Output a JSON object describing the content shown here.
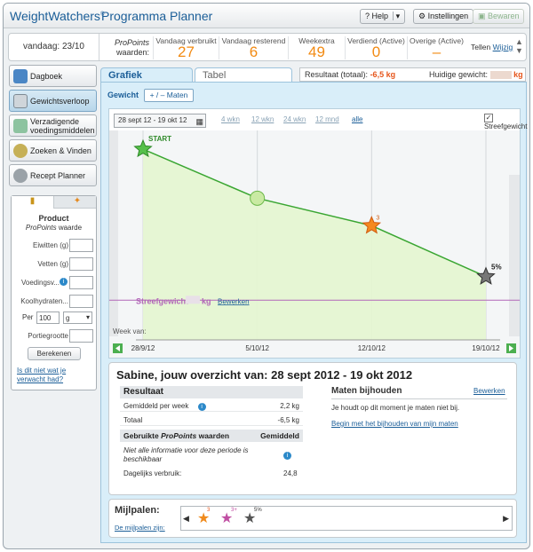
{
  "app": {
    "logo_text": "WeightWatchers",
    "logo_mark": "®",
    "title": "Programma Planner",
    "help_label": "Help",
    "settings_label": "Instellingen",
    "save_label": "Bewaren"
  },
  "stats": {
    "today_label": "vandaag: 23/10",
    "propoints_label": "ProPoints",
    "waarden_label": "waarden:",
    "items": [
      {
        "label": "Vandaag verbruikt",
        "value": "27"
      },
      {
        "label": "Vandaag resterend",
        "value": "6"
      },
      {
        "label": "Weekextra",
        "value": "49"
      },
      {
        "label": "Verdiend (Active)",
        "value": "0"
      },
      {
        "label": "Overige (Active)",
        "value": "–"
      }
    ],
    "tellen_label": "Tellen",
    "wijzig_label": "Wijzig"
  },
  "sidebar": {
    "items": [
      {
        "label": "Dagboek"
      },
      {
        "label": "Gewichtsverloop"
      },
      {
        "label": "Verzadigende voedingsmiddelen"
      },
      {
        "label": "Zoeken & Vinden"
      },
      {
        "label": "Recept Planner"
      }
    ]
  },
  "calculator": {
    "title": "Product",
    "subtitle_em": "ProPoints",
    "subtitle": "waarde",
    "fields": [
      "Eiwitten (g)",
      "Vetten (g)",
      "Voedingsv...",
      "Koolhydraten...",
      "Portiegrootte"
    ],
    "per_label": "Per",
    "per_value": "100",
    "unit_value": "g",
    "calc_button": "Berekenen",
    "help_link": "Is dit niet wat je verwacht had?"
  },
  "tabs": {
    "grafiek": "Grafiek",
    "tabel": "Tabel"
  },
  "results": {
    "label": "Resultaat (totaal):",
    "value": "-6,5 kg",
    "current_label": "Huidige gewicht:",
    "unit": "kg"
  },
  "chart_controls": {
    "weight_tab": "Gewicht",
    "measure_btn": "+ / – Maten",
    "date_range": "28 sept 12 - 19 okt 12",
    "ranges": [
      "4 wkn",
      "12 wkn",
      "24 wkn",
      "12 mnd",
      "alle"
    ],
    "target_checkbox": "Streefgewicht"
  },
  "chart_data": {
    "type": "area",
    "x": [
      "28/9/12",
      "5/10/12",
      "12/10/12",
      "19/10/12"
    ],
    "x_axis_label": "Week van:",
    "points": [
      {
        "date": "28/9/12",
        "marker": "START"
      },
      {
        "date": "5/10/12",
        "marker": ""
      },
      {
        "date": "12/10/12",
        "marker": "3"
      },
      {
        "date": "19/10/12",
        "marker": "5%"
      }
    ],
    "weight_change_kg": [
      0,
      -2.5,
      -3.9,
      -6.5
    ],
    "target_label": "Streefgewicht",
    "target_unit": "kg",
    "target_edit": "Bewerken",
    "colors": {
      "line": "#3aa632",
      "fill": "#e5f5d2",
      "target": "#b267b8"
    }
  },
  "summary": {
    "title": "Sabine, jouw overzicht van: 28 sept 2012 - 19 okt 2012",
    "resultaat_header": "Resultaat",
    "rows": [
      {
        "label": "Gemiddeld per week",
        "value": "2,2 kg"
      },
      {
        "label": "Totaal",
        "value": "-6,5 kg"
      }
    ],
    "pp_header_prefix": "Gebruikte",
    "pp_header_em": "ProPoints",
    "pp_header_suffix": "waarden",
    "pp_avg_header": "Gemiddeld",
    "pp_note": "Niet alle informatie voor deze periode is beschikbaar",
    "daily_label": "Dagelijks verbruik:",
    "daily_value": "24,8",
    "maten_header": "Maten bijhouden",
    "maten_edit": "Bewerken",
    "maten_text": "Je houdt op dit moment je maten niet bij.",
    "maten_link": "Begin met het bijhouden van mijn maten"
  },
  "milestones": {
    "title": "Mijlpalen:",
    "link": "De mijlpalen zijn:",
    "items": [
      "3",
      "3+",
      "5%"
    ]
  }
}
